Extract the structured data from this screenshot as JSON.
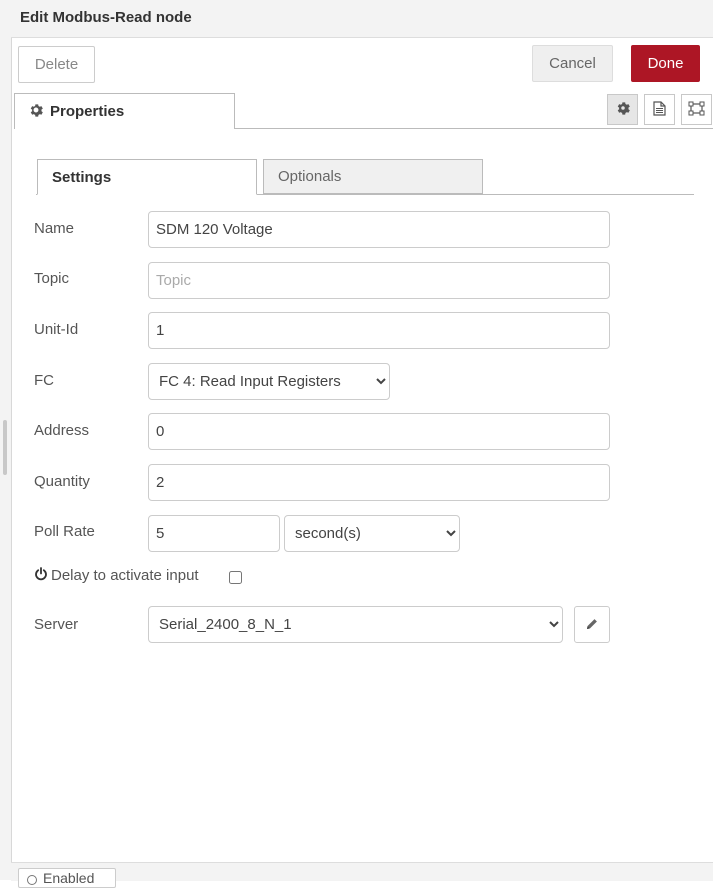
{
  "dialog": {
    "title": "Edit Modbus-Read node",
    "delete_label": "Delete",
    "cancel_label": "Cancel",
    "done_label": "Done",
    "accent_color": "#ad1625"
  },
  "tabs": {
    "properties_label": "Properties",
    "icons": [
      "gear-icon",
      "description-icon",
      "appearance-icon"
    ]
  },
  "sub_tabs": {
    "settings_label": "Settings",
    "optionals_label": "Optionals"
  },
  "form": {
    "name": {
      "label": "Name",
      "value": "SDM 120 Voltage"
    },
    "topic": {
      "label": "Topic",
      "value": "",
      "placeholder": "Topic"
    },
    "unit_id": {
      "label": "Unit-Id",
      "value": "1"
    },
    "fc": {
      "label": "FC",
      "selected": "FC 4: Read Input Registers"
    },
    "address": {
      "label": "Address",
      "value": "0"
    },
    "quantity": {
      "label": "Quantity",
      "value": "2"
    },
    "poll_rate": {
      "label": "Poll Rate",
      "value": "5",
      "unit": "second(s)"
    },
    "delay": {
      "label": "Delay to activate input",
      "checked": false
    },
    "server": {
      "label": "Server",
      "selected": "Serial_2400_8_N_1"
    }
  },
  "footer": {
    "enabled_label": "Enabled"
  }
}
